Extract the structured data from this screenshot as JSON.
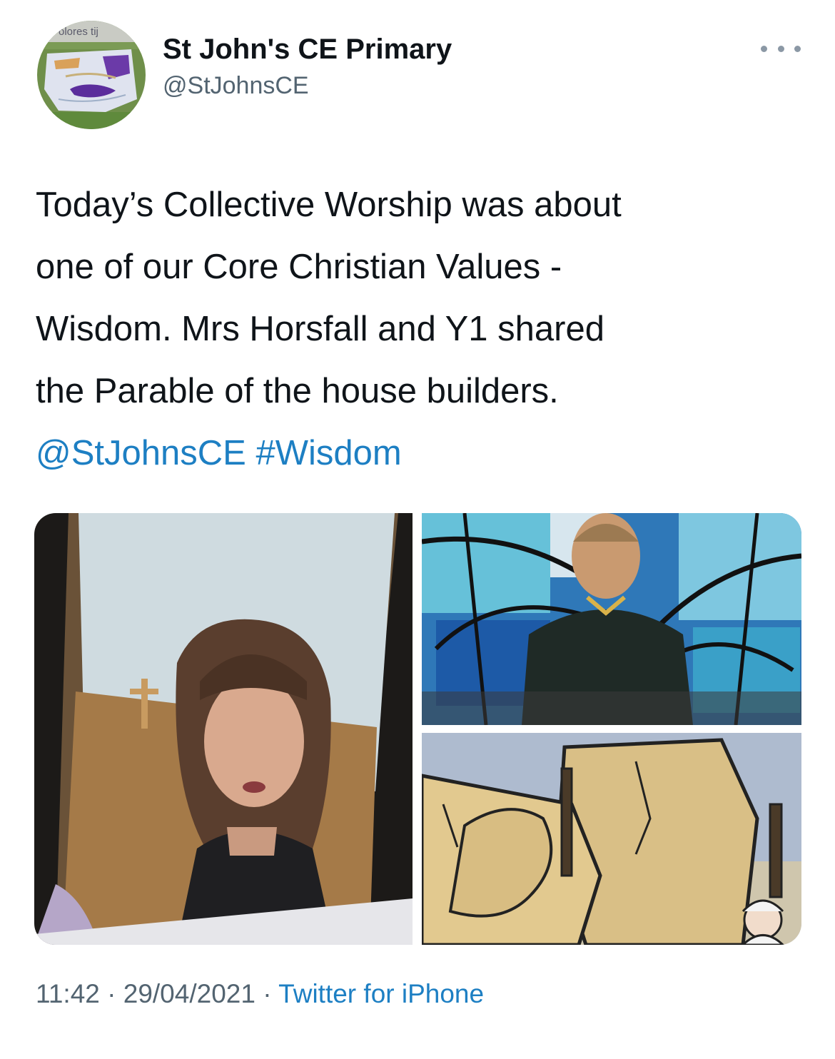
{
  "tweet": {
    "author": {
      "name": "St John's CE Primary",
      "handle": "@StJohnsCE",
      "avatar_alt_text": "olores tij"
    },
    "text_lines": [
      "Today’s Collective Worship was about",
      "one of our Core Christian Values -",
      "Wisdom. Mrs Horsfall and Y1 shared",
      "the Parable of the house builders."
    ],
    "mention": "@StJohnsCE",
    "hashtag": "#Wisdom",
    "photos": [
      {
        "icon": "photo-teacher-worship"
      },
      {
        "icon": "photo-child-stained-glass"
      },
      {
        "icon": "photo-cartoon-house-builders"
      }
    ],
    "time": "11:42",
    "separator": "·",
    "date": "29/04/2021",
    "source": "Twitter for iPhone"
  },
  "colors": {
    "text": "#0f1419",
    "secondary": "#536471",
    "link": "#1d7fc3",
    "background": "#ffffff"
  }
}
